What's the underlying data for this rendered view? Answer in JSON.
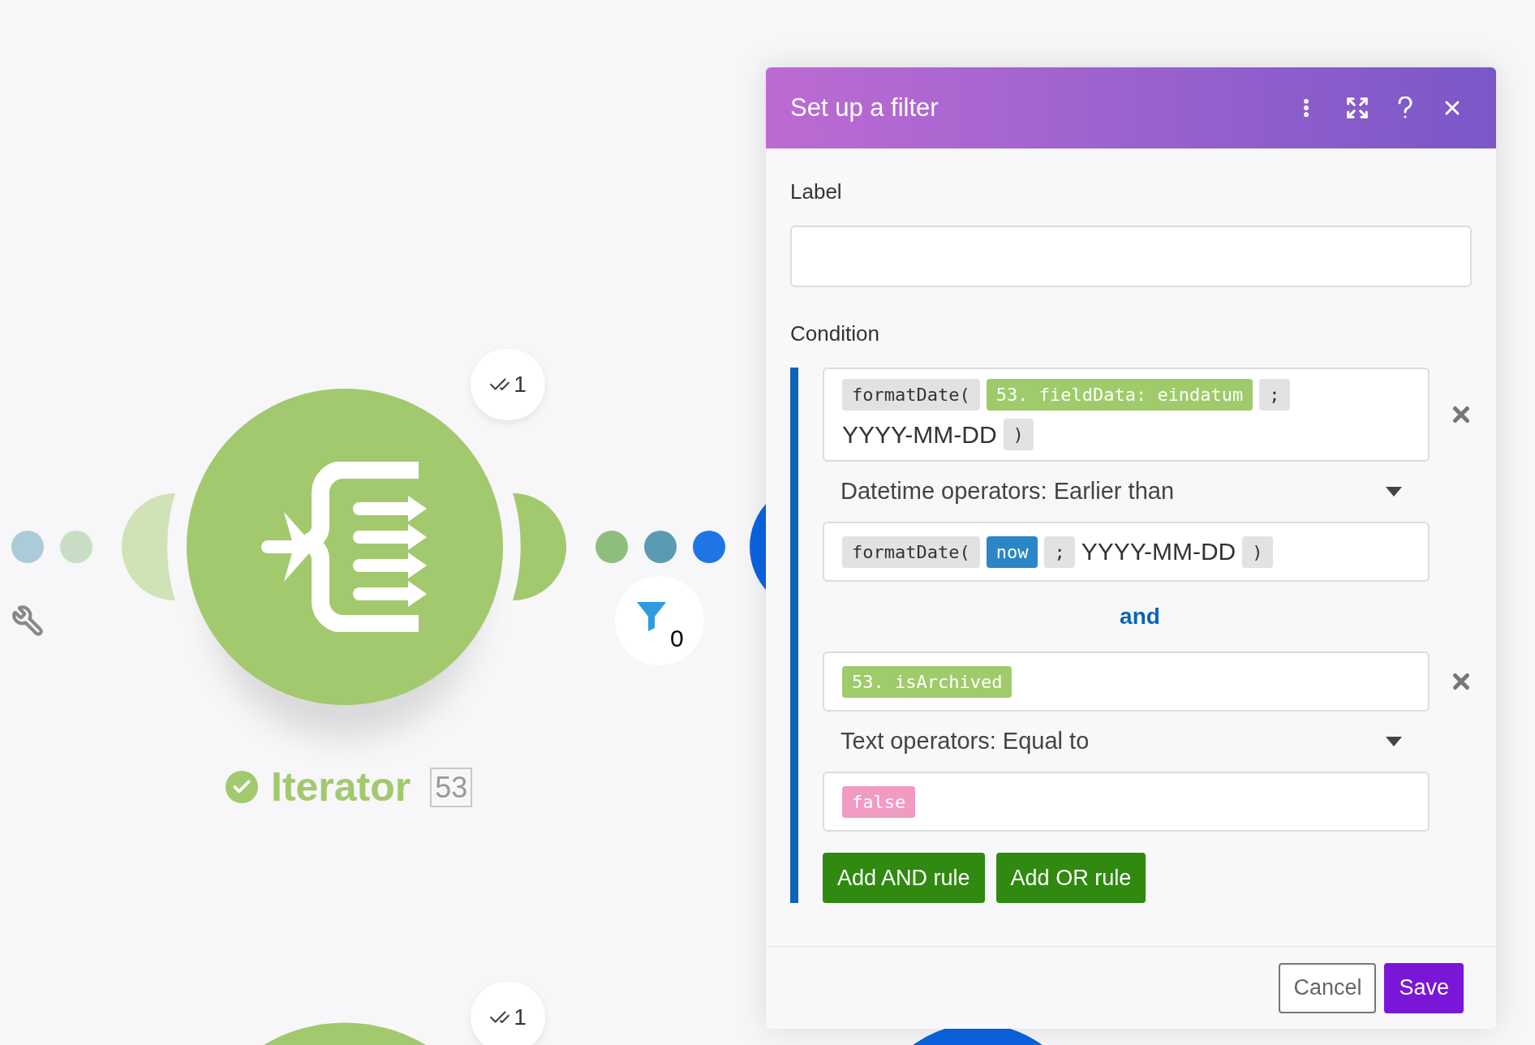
{
  "canvas": {
    "module": {
      "name": "Iterator",
      "number": "53",
      "completed": true,
      "color": "#a2c96e",
      "operations": "1"
    },
    "filter_count": "0",
    "next_module_operations": "1"
  },
  "dialog": {
    "title": "Set up a filter",
    "label_field": {
      "label": "Label"
    },
    "condition": {
      "label": "Condition",
      "rules": [
        {
          "operand": [
            {
              "kind": "function",
              "text": "formatDate("
            },
            {
              "kind": "field",
              "text": "53. fieldData: eindatum"
            },
            {
              "kind": "separator",
              "text": ";"
            },
            {
              "kind": "text",
              "text": "YYYY-MM-DD"
            },
            {
              "kind": "separator",
              "text": ")"
            }
          ],
          "operator": "Datetime operators: Earlier than",
          "value": [
            {
              "kind": "function",
              "text": "formatDate("
            },
            {
              "kind": "keyword",
              "text": "now"
            },
            {
              "kind": "separator",
              "text": ";"
            },
            {
              "kind": "text",
              "text": "YYYY-MM-DD"
            },
            {
              "kind": "separator",
              "text": ")"
            }
          ]
        },
        {
          "operand": [
            {
              "kind": "field",
              "text": "53. isArchived"
            }
          ],
          "operator": "Text operators: Equal to",
          "value": [
            {
              "kind": "literal",
              "text": "false"
            }
          ]
        }
      ],
      "joiner": "and",
      "buttons": [
        "Add AND rule",
        "Add OR rule"
      ]
    },
    "cancel": "Cancel",
    "save": "Save"
  }
}
